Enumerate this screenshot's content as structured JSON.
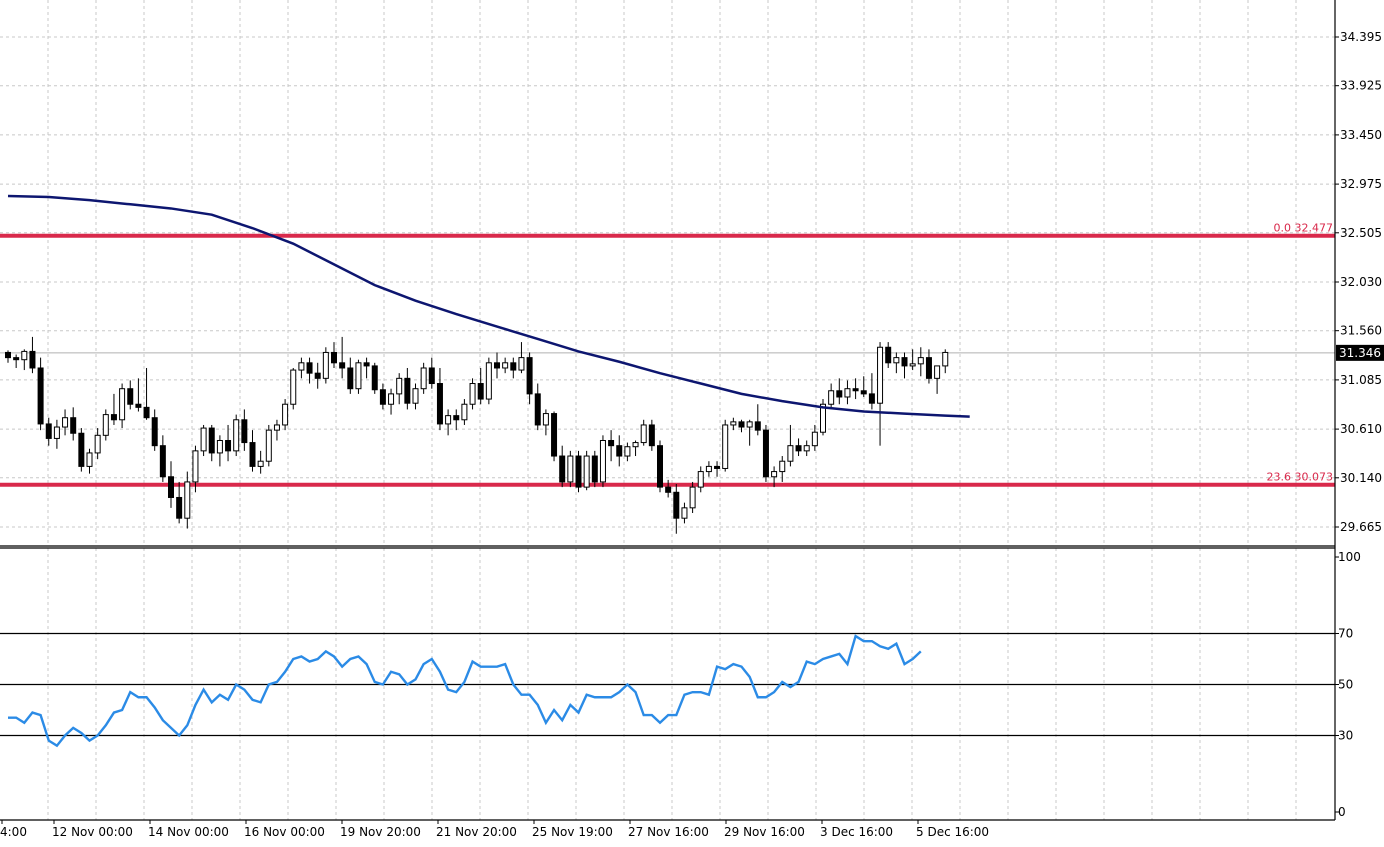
{
  "chart_data": [
    {
      "type": "candlestick",
      "title": "",
      "price_scale": [
        "34.395",
        "33.925",
        "33.450",
        "32.975",
        "32.505",
        "32.030",
        "31.560",
        "31.085",
        "30.610",
        "30.140",
        "29.665"
      ],
      "ylim": [
        29.5,
        34.6
      ],
      "current_price": "31.346",
      "fib_levels": [
        {
          "label": "0.0 32.477",
          "value": 32.477,
          "color": "#d9294b"
        },
        {
          "label": "23.6 30.073",
          "value": 30.073,
          "color": "#d9294b"
        }
      ],
      "moving_average": {
        "color": "#0d1670",
        "points": [
          [
            0,
            32.86
          ],
          [
            5,
            32.85
          ],
          [
            10,
            32.82
          ],
          [
            15,
            32.78
          ],
          [
            20,
            32.74
          ],
          [
            25,
            32.68
          ],
          [
            30,
            32.55
          ],
          [
            35,
            32.4
          ],
          [
            40,
            32.2
          ],
          [
            45,
            32.0
          ],
          [
            50,
            31.85
          ],
          [
            55,
            31.72
          ],
          [
            60,
            31.6
          ],
          [
            65,
            31.48
          ],
          [
            70,
            31.36
          ],
          [
            75,
            31.26
          ],
          [
            80,
            31.15
          ],
          [
            85,
            31.05
          ],
          [
            90,
            30.95
          ],
          [
            95,
            30.88
          ],
          [
            100,
            30.82
          ],
          [
            105,
            30.78
          ],
          [
            110,
            30.76
          ],
          [
            115,
            30.74
          ],
          [
            118,
            30.73
          ]
        ]
      },
      "candles": [
        [
          31.35,
          31.37,
          31.25,
          31.3
        ],
        [
          31.3,
          31.33,
          31.2,
          31.28
        ],
        [
          31.28,
          31.38,
          31.18,
          31.36
        ],
        [
          31.36,
          31.5,
          31.15,
          31.2
        ],
        [
          31.2,
          31.3,
          30.6,
          30.66
        ],
        [
          30.66,
          30.72,
          30.45,
          30.52
        ],
        [
          30.52,
          30.7,
          30.42,
          30.63
        ],
        [
          30.63,
          30.8,
          30.55,
          30.72
        ],
        [
          30.72,
          30.82,
          30.5,
          30.57
        ],
        [
          30.57,
          30.62,
          30.2,
          30.25
        ],
        [
          30.25,
          30.42,
          30.18,
          30.38
        ],
        [
          30.38,
          30.62,
          30.32,
          30.55
        ],
        [
          30.55,
          30.8,
          30.5,
          30.75
        ],
        [
          30.75,
          30.95,
          30.65,
          30.7
        ],
        [
          30.7,
          31.05,
          30.62,
          31.0
        ],
        [
          31.0,
          31.08,
          30.8,
          30.85
        ],
        [
          30.85,
          31.1,
          30.78,
          30.82
        ],
        [
          30.82,
          31.2,
          30.7,
          30.72
        ],
        [
          30.72,
          30.8,
          30.4,
          30.45
        ],
        [
          30.45,
          30.55,
          30.1,
          30.15
        ],
        [
          30.15,
          30.3,
          29.85,
          29.95
        ],
        [
          29.95,
          30.1,
          29.7,
          29.75
        ],
        [
          29.75,
          30.2,
          29.65,
          30.1
        ],
        [
          30.1,
          30.45,
          30.0,
          30.4
        ],
        [
          30.4,
          30.65,
          30.35,
          30.62
        ],
        [
          30.62,
          30.65,
          30.3,
          30.38
        ],
        [
          30.38,
          30.55,
          30.25,
          30.5
        ],
        [
          30.5,
          30.65,
          30.3,
          30.4
        ],
        [
          30.4,
          30.75,
          30.35,
          30.7
        ],
        [
          30.7,
          30.8,
          30.4,
          30.48
        ],
        [
          30.48,
          30.6,
          30.2,
          30.25
        ],
        [
          30.25,
          30.4,
          30.18,
          30.3
        ],
        [
          30.3,
          30.65,
          30.25,
          30.6
        ],
        [
          30.6,
          30.7,
          30.5,
          30.65
        ],
        [
          30.65,
          30.9,
          30.6,
          30.85
        ],
        [
          30.85,
          31.2,
          30.8,
          31.18
        ],
        [
          31.18,
          31.3,
          31.1,
          31.25
        ],
        [
          31.25,
          31.3,
          31.05,
          31.15
        ],
        [
          31.15,
          31.25,
          31.0,
          31.1
        ],
        [
          31.1,
          31.4,
          31.05,
          31.35
        ],
        [
          31.35,
          31.45,
          31.2,
          31.25
        ],
        [
          31.25,
          31.5,
          31.1,
          31.2
        ],
        [
          31.2,
          31.3,
          30.95,
          31.0
        ],
        [
          31.0,
          31.28,
          30.95,
          31.25
        ],
        [
          31.25,
          31.3,
          31.1,
          31.22
        ],
        [
          31.22,
          31.25,
          30.95,
          30.99
        ],
        [
          30.99,
          31.05,
          30.8,
          30.85
        ],
        [
          30.85,
          31.0,
          30.75,
          30.95
        ],
        [
          30.95,
          31.15,
          30.85,
          31.1
        ],
        [
          31.1,
          31.2,
          30.8,
          30.86
        ],
        [
          30.86,
          31.05,
          30.8,
          31.0
        ],
        [
          31.0,
          31.25,
          30.95,
          31.2
        ],
        [
          31.2,
          31.3,
          31.0,
          31.05
        ],
        [
          31.05,
          31.2,
          30.6,
          30.66
        ],
        [
          30.66,
          30.8,
          30.55,
          30.74
        ],
        [
          30.74,
          30.8,
          30.6,
          30.7
        ],
        [
          30.7,
          30.9,
          30.65,
          30.85
        ],
        [
          30.85,
          31.1,
          30.8,
          31.05
        ],
        [
          31.05,
          31.2,
          30.85,
          30.9
        ],
        [
          30.9,
          31.3,
          30.85,
          31.25
        ],
        [
          31.25,
          31.35,
          31.1,
          31.2
        ],
        [
          31.2,
          31.3,
          31.15,
          31.25
        ],
        [
          31.25,
          31.3,
          31.1,
          31.18
        ],
        [
          31.18,
          31.45,
          31.15,
          31.3
        ],
        [
          31.3,
          31.35,
          30.85,
          30.95
        ],
        [
          30.95,
          31.05,
          30.6,
          30.65
        ],
        [
          30.65,
          30.8,
          30.55,
          30.76
        ],
        [
          30.76,
          30.78,
          30.3,
          30.35
        ],
        [
          30.35,
          30.45,
          30.05,
          30.1
        ],
        [
          30.1,
          30.4,
          30.05,
          30.35
        ],
        [
          30.35,
          30.4,
          30.0,
          30.05
        ],
        [
          30.05,
          30.4,
          30.02,
          30.35
        ],
        [
          30.35,
          30.4,
          30.05,
          30.1
        ],
        [
          30.1,
          30.55,
          30.05,
          30.5
        ],
        [
          30.5,
          30.6,
          30.3,
          30.45
        ],
        [
          30.45,
          30.55,
          30.25,
          30.35
        ],
        [
          30.35,
          30.48,
          30.3,
          30.44
        ],
        [
          30.44,
          30.5,
          30.35,
          30.48
        ],
        [
          30.48,
          30.7,
          30.45,
          30.65
        ],
        [
          30.65,
          30.7,
          30.4,
          30.45
        ],
        [
          30.45,
          30.5,
          30.0,
          30.05
        ],
        [
          30.05,
          30.12,
          29.95,
          30.0
        ],
        [
          30.0,
          30.08,
          29.6,
          29.75
        ],
        [
          29.75,
          29.9,
          29.7,
          29.85
        ],
        [
          29.85,
          30.1,
          29.8,
          30.05
        ],
        [
          30.05,
          30.25,
          30.0,
          30.2
        ],
        [
          30.2,
          30.3,
          30.15,
          30.25
        ],
        [
          30.25,
          30.3,
          30.15,
          30.23
        ],
        [
          30.23,
          30.7,
          30.2,
          30.65
        ],
        [
          30.65,
          30.72,
          30.6,
          30.68
        ],
        [
          30.68,
          30.7,
          30.58,
          30.63
        ],
        [
          30.63,
          30.7,
          30.45,
          30.68
        ],
        [
          30.68,
          30.85,
          30.55,
          30.6
        ],
        [
          30.6,
          30.65,
          30.1,
          30.15
        ],
        [
          30.15,
          30.25,
          30.05,
          30.2
        ],
        [
          30.2,
          30.35,
          30.1,
          30.3
        ],
        [
          30.3,
          30.65,
          30.25,
          30.45
        ],
        [
          30.45,
          30.52,
          30.35,
          30.4
        ],
        [
          30.4,
          30.5,
          30.35,
          30.45
        ],
        [
          30.45,
          30.65,
          30.4,
          30.58
        ],
        [
          30.58,
          30.9,
          30.55,
          30.85
        ],
        [
          30.85,
          31.05,
          30.8,
          30.98
        ],
        [
          30.98,
          31.1,
          30.85,
          30.92
        ],
        [
          30.92,
          31.08,
          30.85,
          31.0
        ],
        [
          31.0,
          31.1,
          30.9,
          30.98
        ],
        [
          30.98,
          31.12,
          30.92,
          30.95
        ],
        [
          30.95,
          31.15,
          30.8,
          30.86
        ],
        [
          30.86,
          31.45,
          30.45,
          31.4
        ],
        [
          31.4,
          31.45,
          31.2,
          31.25
        ],
        [
          31.25,
          31.35,
          31.15,
          31.3
        ],
        [
          31.3,
          31.35,
          31.1,
          31.22
        ],
        [
          31.22,
          31.38,
          31.18,
          31.24
        ],
        [
          31.24,
          31.4,
          31.12,
          31.3
        ],
        [
          31.3,
          31.38,
          31.05,
          31.1
        ],
        [
          31.1,
          31.2,
          30.95,
          31.22
        ],
        [
          31.22,
          31.38,
          31.15,
          31.35
        ]
      ],
      "x_ticks": [
        "4:00",
        "12 Nov 00:00",
        "14 Nov 00:00",
        "16 Nov 00:00",
        "19 Nov 20:00",
        "21 Nov 20:00",
        "25 Nov 19:00",
        "27 Nov 16:00",
        "29 Nov 16:00",
        "3 Dec 16:00",
        "5 Dec 16:00"
      ],
      "grid": true
    },
    {
      "type": "line",
      "title": "",
      "ylim": [
        0,
        100
      ],
      "y_ticks": [
        "100",
        "70",
        "50",
        "30",
        "0"
      ],
      "levels": [
        70,
        50,
        30
      ],
      "series": [
        {
          "color": "#2b8be6",
          "values": [
            37,
            37,
            35,
            39,
            38,
            28,
            26,
            30,
            33,
            31,
            28,
            30,
            34,
            39,
            40,
            47,
            45,
            45,
            41,
            36,
            33,
            30,
            34,
            42,
            48,
            43,
            46,
            44,
            50,
            48,
            44,
            43,
            50,
            51,
            55,
            60,
            61,
            59,
            60,
            63,
            61,
            57,
            60,
            61,
            58,
            51,
            50,
            55,
            54,
            50,
            52,
            58,
            60,
            55,
            48,
            47,
            51,
            59,
            57,
            57,
            57,
            58,
            50,
            46,
            46,
            42,
            35,
            40,
            36,
            42,
            39,
            46,
            45,
            45,
            45,
            47,
            50,
            47,
            38,
            38,
            35,
            38,
            38,
            46,
            47,
            47,
            46,
            57,
            56,
            58,
            57,
            53,
            45,
            45,
            47,
            51,
            49,
            51,
            59,
            58,
            60,
            61,
            62,
            58,
            69,
            67,
            67,
            65,
            64,
            66,
            58,
            60,
            63
          ]
        }
      ]
    }
  ]
}
